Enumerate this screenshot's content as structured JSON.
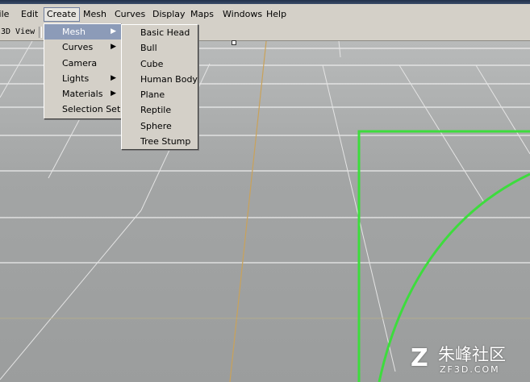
{
  "menubar": {
    "items": [
      {
        "label": "File"
      },
      {
        "label": "Edit"
      },
      {
        "label": "Create"
      },
      {
        "label": "Mesh"
      },
      {
        "label": "Curves"
      },
      {
        "label": "Display"
      },
      {
        "label": "Maps"
      },
      {
        "label": "Windows"
      },
      {
        "label": "Help"
      }
    ],
    "active": "Create"
  },
  "toolbar": {
    "view_label": "3D View"
  },
  "create_menu": {
    "items": [
      {
        "label": "Mesh",
        "has_submenu": true,
        "highlighted": true
      },
      {
        "label": "Curves",
        "has_submenu": true
      },
      {
        "label": "Camera",
        "has_submenu": false
      },
      {
        "label": "Lights",
        "has_submenu": true
      },
      {
        "label": "Materials",
        "has_submenu": true
      },
      {
        "label": "Selection Set",
        "has_submenu": false
      }
    ],
    "submenu_arrow": "▶"
  },
  "mesh_submenu": {
    "items": [
      {
        "label": "Basic Head"
      },
      {
        "label": "Bull"
      },
      {
        "label": "Cube"
      },
      {
        "label": "Human Body"
      },
      {
        "label": "Plane"
      },
      {
        "label": "Reptile"
      },
      {
        "label": "Sphere"
      },
      {
        "label": "Tree Stump"
      }
    ]
  },
  "watermark": {
    "chinese": "朱峰社区",
    "domain": "ZF3D.COM"
  },
  "colors": {
    "menu_bg": "#d4d0c8",
    "highlight": "#8c9bb8",
    "grid_line": "#e8e8e8",
    "axis_line": "#c8a050",
    "selection": "#3ddc3d"
  }
}
